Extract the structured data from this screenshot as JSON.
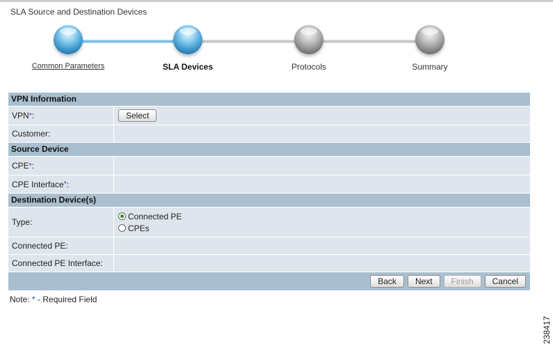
{
  "page": {
    "title": "SLA Source and Destination Devices"
  },
  "wizard": {
    "steps": [
      {
        "label": "Common Parameters",
        "state": "completed"
      },
      {
        "label": "SLA Devices",
        "state": "current"
      },
      {
        "label": "Protocols",
        "state": "pending"
      },
      {
        "label": "Summary",
        "state": "pending"
      }
    ],
    "colors": {
      "completed": "#3b93c9",
      "pending": "#8a8a8a"
    }
  },
  "form": {
    "sections": {
      "vpn": "VPN Information",
      "source": "Source Device",
      "destination": "Destination Device(s)"
    },
    "fields": {
      "vpn": {
        "label": "VPN",
        "required_mark": "*",
        "suffix": ":",
        "button": "Select"
      },
      "customer": {
        "label": "Customer:",
        "value": ""
      },
      "cpe": {
        "label": "CPE",
        "required_mark": "*",
        "suffix": ":",
        "value": ""
      },
      "cpe_interface": {
        "label": "CPE Interface",
        "required_mark": "*",
        "suffix": ":",
        "value": ""
      },
      "type": {
        "label": "Type:",
        "options": [
          "Connected PE",
          "CPEs"
        ],
        "selected": "Connected PE"
      },
      "connected_pe": {
        "label": "Connected PE:",
        "value": ""
      },
      "connected_pe_interface": {
        "label": "Connected PE Interface:",
        "value": ""
      }
    },
    "buttons": {
      "back": "Back",
      "next": "Next",
      "finish": "Finish",
      "cancel": "Cancel"
    }
  },
  "note": {
    "prefix": "Note:",
    "star": "*",
    "text": "- Required Field"
  },
  "figure_id": "238417",
  "colors": {
    "section_header": "#a9bfcf",
    "row_bg": "#dfe5ec",
    "required": "#2040c0"
  }
}
